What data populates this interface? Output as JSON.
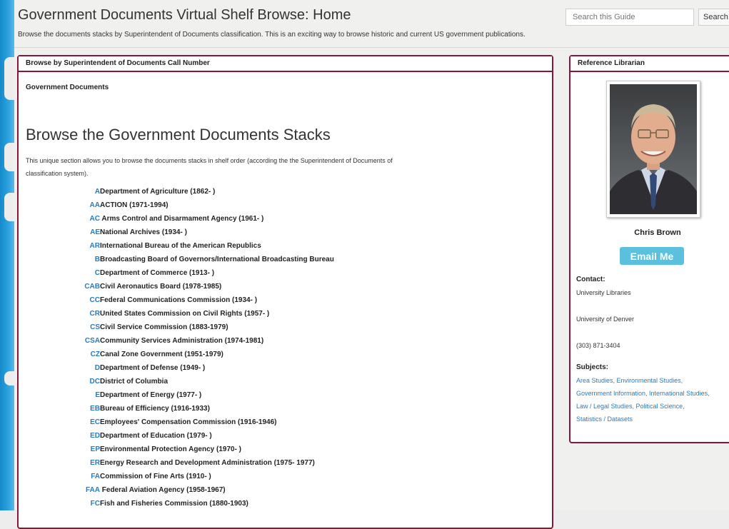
{
  "header": {
    "title": "Government Documents Virtual Shelf Browse: Home",
    "subtitle": "Browse the documents stacks by Superintendent of Documents classification. This is an exciting way to browse historic and current US government publications.",
    "search_placeholder": "Search this Guide",
    "search_button": "Search"
  },
  "main_box": {
    "heading": "Browse by Superintendent of Documents Call Number",
    "sub_label": "Government Documents",
    "section_title": "Browse the Government Documents Stacks",
    "intro": "This unique section allows you to browse the documents stacks in shelf order (according the the Superintendent of Documents of classification system).",
    "agencies": [
      {
        "code": "A",
        "name": "Department of Agriculture (1862- )"
      },
      {
        "code": "AA",
        "name": "ACTION (1971-1994)"
      },
      {
        "code": "AC",
        "name": " Arms Control and Disarmament Agency (1961- )"
      },
      {
        "code": "AE",
        "name": "National Archives (1934- )"
      },
      {
        "code": "AR",
        "name": "International Bureau of the American Republics"
      },
      {
        "code": "B",
        "name": "Broadcasting Board of Governors/International Broadcasting Bureau"
      },
      {
        "code": "C",
        "name": "Department of Commerce (1913- )"
      },
      {
        "code": "CAB",
        "name": "Civil Aeronautics Board (1978-1985)"
      },
      {
        "code": "CC",
        "name": "Federal Communications Commission (1934- )"
      },
      {
        "code": "CR",
        "name": "United States Commission on Civil Rights (1957- )"
      },
      {
        "code": "CS",
        "name": "Civil Service Commission (1883-1979)"
      },
      {
        "code": "CSA",
        "name": "Community Services Administration (1974-1981)"
      },
      {
        "code": "CZ",
        "name": "Canal Zone Government (1951-1979)"
      },
      {
        "code": "D",
        "name": "Department of Defense (1949- )"
      },
      {
        "code": "DC",
        "name": "District of Columbia"
      },
      {
        "code": "E",
        "name": "Department of Energy (1977- )"
      },
      {
        "code": "EB",
        "name": "Bureau of Efficiency (1916-1933)"
      },
      {
        "code": "EC",
        "name": "Employees' Compensation Commission (1916-1946)"
      },
      {
        "code": "ED",
        "name": "Department of Education (1979- )"
      },
      {
        "code": "EP",
        "name": "Environmental Protection Agency (1970- )"
      },
      {
        "code": "ER",
        "name": "Energy Research and Development Administration (1975- 1977)"
      },
      {
        "code": "FA",
        "name": "Commission of Fine Arts (1910- )"
      },
      {
        "code": "FAA",
        "name": " Federal Aviation Agency (1958-1967)"
      },
      {
        "code": "FC",
        "name": "Fish and Fisheries Commission (1880-1903)"
      }
    ]
  },
  "side_box": {
    "heading": "Reference Librarian",
    "name": "Chris Brown",
    "email_button": "Email Me",
    "contact_label": "Contact:",
    "contact": {
      "line1": "University Libraries",
      "line2": "University of Denver",
      "phone": "(303) 871-3404"
    },
    "subjects_label": "Subjects:",
    "subjects": "Area Studies, Environmental Studies, Government Information, International Studies, Law / Legal Studies, Political Science, Statistics / Datasets"
  },
  "colors": {
    "accent_border": "#8a1538",
    "link": "#2a7bbf",
    "email_button": "#5bc0de"
  },
  "icons": [
    "librarian-photo"
  ]
}
